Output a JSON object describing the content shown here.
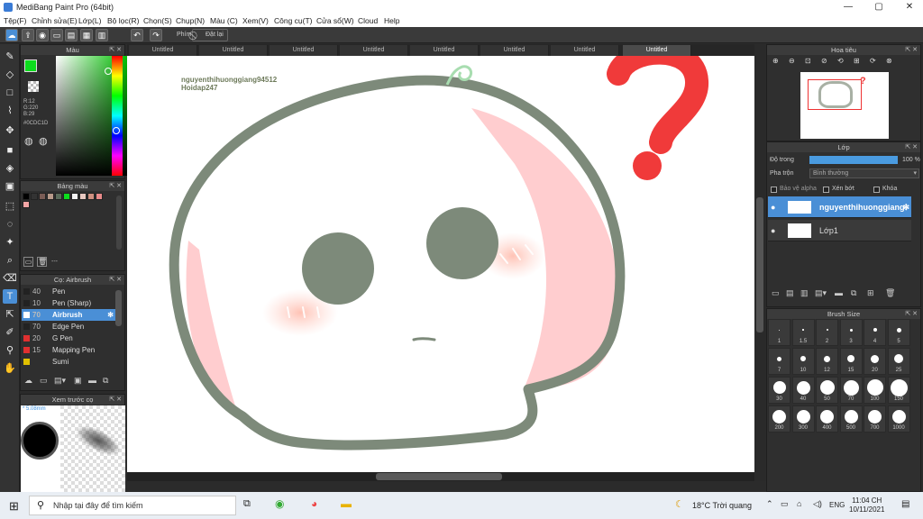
{
  "window": {
    "title": "MediBang Paint Pro (64bit)",
    "min": "—",
    "max": "▢",
    "close": "✕"
  },
  "menu": [
    "Tệp(F)",
    "Chỉnh sửa(E)",
    "Lớp(L)",
    "Bộ lọc(R)",
    "Chọn(S)",
    "Chụp(N)",
    "Màu (C)",
    "Xem(V)",
    "Công cụ(T)",
    "Cửa sổ(W)",
    "Cloud",
    "Help"
  ],
  "toolbar": {
    "pen_label": "Phím",
    "reset_label": "Đặt lại"
  },
  "tabs": [
    "Untitled",
    "Untitled",
    "Untitled",
    "Untitled",
    "Untitled",
    "Untitled",
    "Untitled",
    "Untitled"
  ],
  "color_panel": {
    "title": "Màu",
    "r": "R:12",
    "g": "G:220",
    "b": "B:29",
    "hex": "#0CDC1D",
    "primary": "#0CDC1D"
  },
  "palette": {
    "title": "Bảng màu",
    "colors": [
      "#000000",
      "#333333",
      "#7a5c55",
      "#b89a8a",
      "#5a6a5a",
      "#0CDC1D",
      "#f2f2f2",
      "#e8c8c0",
      "#d09080",
      "#e88a8a",
      "#f4a6a6"
    ],
    "more": "---"
  },
  "brush_panel": {
    "title": "Cọ: Airbrush",
    "brushes": [
      {
        "size": "40",
        "name": "Pen",
        "color": "#222222"
      },
      {
        "size": "10",
        "name": "Pen (Sharp)",
        "color": "#222222"
      },
      {
        "size": "70",
        "name": "Airbrush",
        "color": "#ffffff",
        "selected": true
      },
      {
        "size": "70",
        "name": "Edge Pen",
        "color": "#222222"
      },
      {
        "size": "20",
        "name": "G Pen",
        "color": "#e03030"
      },
      {
        "size": "15",
        "name": "Mapping Pen",
        "color": "#e03030"
      },
      {
        "size": "",
        "name": "Sumi",
        "color": "#e0c000"
      }
    ]
  },
  "preview_panel": {
    "title": "Xem trước cọ",
    "size": "* 5.08mm"
  },
  "canvas": {
    "watermark_line1": "nguyenthihuonggiang94512",
    "watermark_line2": "Hoidap247",
    "outline_color": "#7d8a7a",
    "blush_color": "#ffc9c9",
    "question_color": "#f03a3a"
  },
  "navigator": {
    "title": "Hoa tiêu"
  },
  "layers_panel": {
    "title": "Lớp",
    "opacity_label": "Độ trong",
    "opacity_value": "100 %",
    "blend_label": "Pha trộn",
    "blend_value": "Bình thường",
    "protect_alpha": "Bảo vệ alpha",
    "clip": "Xén bớt",
    "lock": "Khóa",
    "layers": [
      {
        "name": "nguyenthihuonggiang",
        "selected": true
      },
      {
        "name": "Lớp1",
        "selected": false
      }
    ]
  },
  "brush_size": {
    "title": "Brush Size",
    "sizes": [
      "1",
      "1.5",
      "2",
      "3",
      "4",
      "5",
      "7",
      "10",
      "12",
      "15",
      "20",
      "25",
      "30",
      "40",
      "50",
      "70",
      "100",
      "150",
      "200",
      "300",
      "400",
      "500",
      "700",
      "1000"
    ]
  },
  "taskbar": {
    "search_placeholder": "Nhập tại đây để tìm kiếm",
    "weather": "18°C  Trời quang",
    "lang": "ENG",
    "time": "11:04 CH",
    "date": "10/11/2021"
  }
}
